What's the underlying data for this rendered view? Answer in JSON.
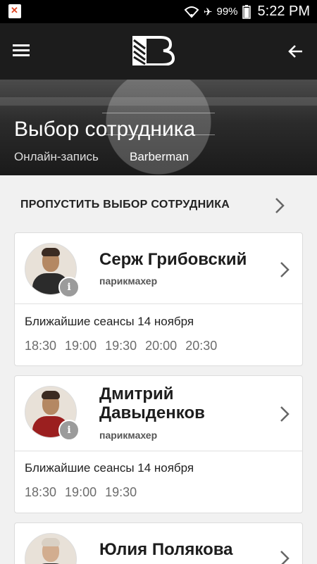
{
  "status": {
    "battery": "99%",
    "time": "5:22 PM"
  },
  "header": {
    "title": "Выбор сотрудника",
    "subtitle": "Онлайн-запись",
    "place": "Barberman"
  },
  "skip": {
    "label": "ПРОПУСТИТЬ ВЫБОР СОТРУДНИКА"
  },
  "staff": [
    {
      "name": "Серж Грибовский",
      "role": "парикмахер",
      "sessions_label": "Ближайшие сеансы 14 ноября",
      "slots": [
        "18:30",
        "19:00",
        "19:30",
        "20:00",
        "20:30"
      ]
    },
    {
      "name": "Дмитрий Давыденков",
      "role": "парикмахер",
      "sessions_label": "Ближайшие сеансы 14 ноября",
      "slots": [
        "18:30",
        "19:00",
        "19:30"
      ]
    },
    {
      "name": "Юлия Полякова"
    }
  ]
}
